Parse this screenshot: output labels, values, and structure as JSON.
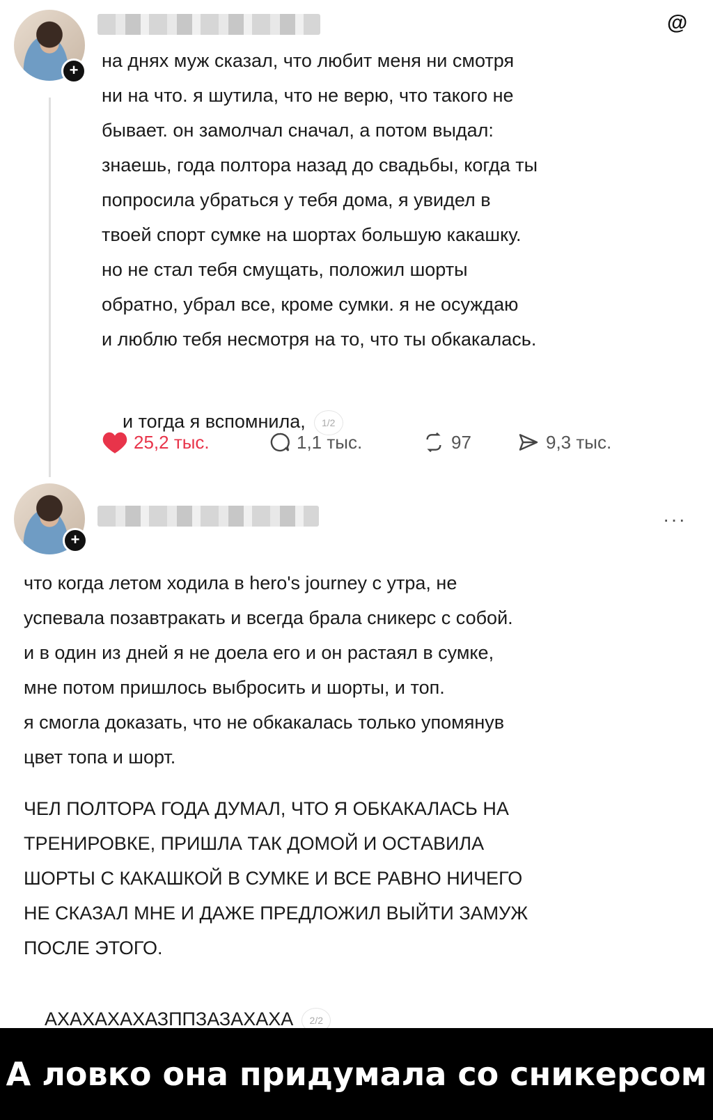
{
  "post1": {
    "username": "",
    "text": "на днях муж сказал, что любит меня ни смотря\nни на что. я шутила, что не верю, что такого не\nбывает. он замолчал сначал, а потом выдал:\nзнаешь, года полтора назад до свадьбы, когда ты\nпопросила убраться у тебя дома, я увидел в\nтвоей спорт сумке на шортах большую какашку.\nно не стал тебя смущать, положил шорты\nобратно, убрал все, кроме сумки. я не осуждаю\nи люблю тебя несмотря на то, что ты обкакалась.",
    "continuation": "и тогда я вспомнила,",
    "page_indicator": "1/2",
    "likes": "25,2 тыс.",
    "comments": "1,1 тыс.",
    "reposts": "97",
    "shares": "9,3 тыс.",
    "like_color": "#e8344a",
    "icons": [
      "threads-icon",
      "heart-icon",
      "comment-icon",
      "repost-icon",
      "share-icon",
      "plus-icon"
    ]
  },
  "post2": {
    "username": "",
    "text": "что когда летом ходила в hero's journey с утра, не\nуспевала позавтракать и всегда брала сникерс с собой.\nи в один из дней я не доела его и он растаял в сумке,\nмне потом пришлось выбросить и шорты, и топ.\nя смогла доказать, что не обкакалась только упомянув\nцвет топа и шорт.",
    "caps_text": "ЧЕЛ ПОЛТОРА ГОДА ДУМАЛ, ЧТО Я ОБКАКАЛАСЬ НА\nТРЕНИРОВКЕ, ПРИШЛА ТАК ДОМОЙ И ОСТАВИЛА\nШОРТЫ С КАКАШКОЙ В СУМКЕ И ВСЕ РАВНО НИЧЕГО\nНЕ СКАЗАЛ МНЕ И ДАЖЕ ПРЕДЛОЖИЛ ВЫЙТИ ЗАМУЖ\nПОСЛЕ ЭТОГО.",
    "laugh": "АХАХАХАХАЗППЗАЗАХАХА",
    "page_indicator": "2/2",
    "more": "···"
  },
  "caption": "А ловко она придумала со сникерсом"
}
